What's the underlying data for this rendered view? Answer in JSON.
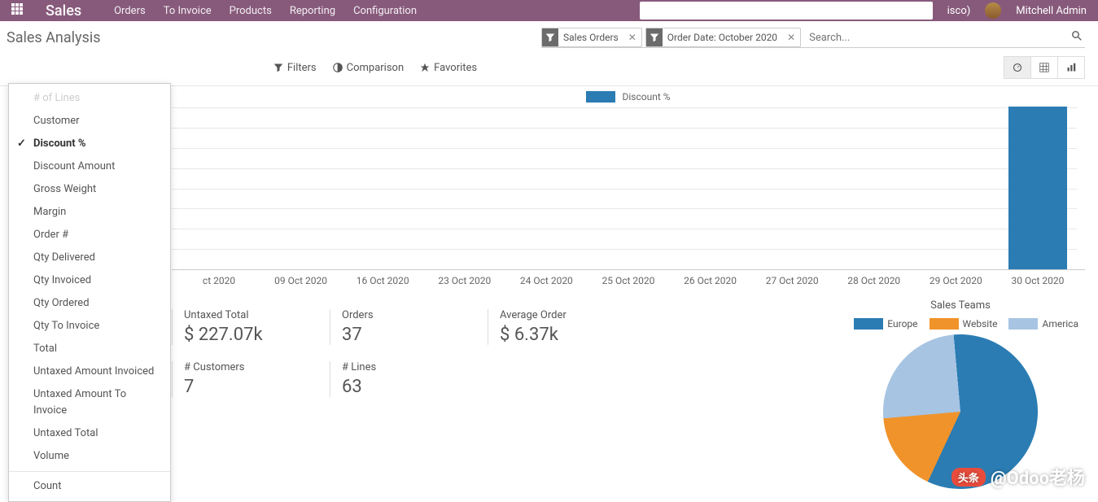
{
  "nav": {
    "brand": "Sales",
    "items": [
      "Orders",
      "To Invoice",
      "Products",
      "Reporting",
      "Configuration"
    ],
    "company_suffix": "isco)",
    "user": "Mitchell Admin"
  },
  "page_title": "Sales Analysis",
  "search": {
    "facets": [
      {
        "label": "Sales Orders"
      },
      {
        "label": "Order Date: October 2020"
      }
    ],
    "placeholder": "Search..."
  },
  "filter_buttons": {
    "filters": "Filters",
    "comparison": "Comparison",
    "favorites": "Favorites"
  },
  "measures_menu": {
    "items": [
      {
        "label": "# of Lines",
        "hidden_top": true
      },
      {
        "label": "Customer"
      },
      {
        "label": "Discount %",
        "selected": true
      },
      {
        "label": "Discount Amount"
      },
      {
        "label": "Gross Weight"
      },
      {
        "label": "Margin"
      },
      {
        "label": "Order #"
      },
      {
        "label": "Qty Delivered"
      },
      {
        "label": "Qty Invoiced"
      },
      {
        "label": "Qty Ordered"
      },
      {
        "label": "Qty To Invoice"
      },
      {
        "label": "Total"
      },
      {
        "label": "Untaxed Amount Invoiced"
      },
      {
        "label": "Untaxed Amount To Invoice"
      },
      {
        "label": "Untaxed Total"
      },
      {
        "label": "Volume"
      }
    ],
    "count_label": "Count"
  },
  "chart_data": {
    "type": "bar",
    "title": "Discount %",
    "categories": [
      "ct 2020",
      "09 Oct 2020",
      "16 Oct 2020",
      "23 Oct 2020",
      "24 Oct 2020",
      "25 Oct 2020",
      "26 Oct 2020",
      "27 Oct 2020",
      "28 Oct 2020",
      "29 Oct 2020",
      "30 Oct 2020"
    ],
    "values": [
      0,
      0,
      0,
      0,
      0,
      0,
      0,
      0,
      0,
      0,
      10
    ],
    "xlabel": "",
    "ylabel": "Discount %",
    "ylim": [
      0,
      10
    ]
  },
  "kpis": {
    "row1": [
      {
        "label": "Untaxed Total",
        "value": "$ 227.07k"
      },
      {
        "label": "Orders",
        "value": "37"
      },
      {
        "label": "Average Order",
        "value": "$ 6.37k"
      }
    ],
    "row2": [
      {
        "label": "# Customers",
        "value": "7"
      },
      {
        "label": "# Lines",
        "value": "63"
      }
    ]
  },
  "teams": {
    "title": "Sales Teams",
    "legend": [
      {
        "label": "Europe",
        "color": "#2b7cb3"
      },
      {
        "label": "Website",
        "color": "#f0932b"
      },
      {
        "label": "America",
        "color": "#a7c4e2"
      }
    ],
    "pie_data": {
      "type": "pie",
      "slices": [
        {
          "label": "Europe",
          "value": 58
        },
        {
          "label": "Website",
          "value": 17
        },
        {
          "label": "America",
          "value": 25
        }
      ]
    }
  },
  "watermark": {
    "badge": "头条",
    "text": "@Odoo老杨"
  }
}
